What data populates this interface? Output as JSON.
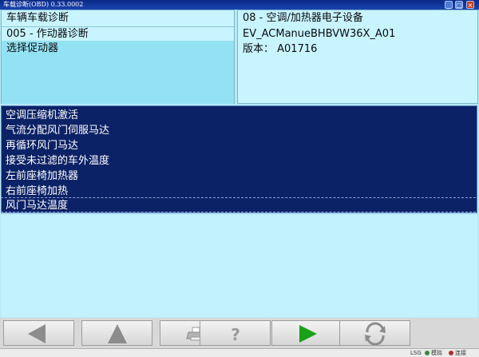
{
  "window": {
    "title": "车载诊断(OBD) 0.33.0002"
  },
  "left_panel": {
    "line1": "车辆车载诊断",
    "line2": "005 - 作动器诊断",
    "line3": "选择促动器"
  },
  "right_panel": {
    "line1": "08 - 空调/加热器电子设备",
    "line2": "EV_ACManueBHBVW36X_A01",
    "line3": "版本：  A01716"
  },
  "actuators": [
    "空调压缩机激活",
    "气流分配风门伺服马达",
    "再循环风门马达",
    "接受未过滤的车外温度",
    "左前座椅加热器",
    "右前座椅加热",
    "风门马达温度"
  ],
  "toolbar": {
    "buttons": [
      {
        "icon": "arrow-left-icon"
      },
      {
        "icon": "arrow-up-icon"
      },
      {
        "icon": "print-icon"
      },
      {
        "icon": "help-icon"
      },
      {
        "icon": "play-icon",
        "color": "#1aa11a"
      },
      {
        "icon": "refresh-icon"
      }
    ]
  },
  "status": {
    "field1": "LSG",
    "field2": "模拟",
    "field3": "连接"
  }
}
